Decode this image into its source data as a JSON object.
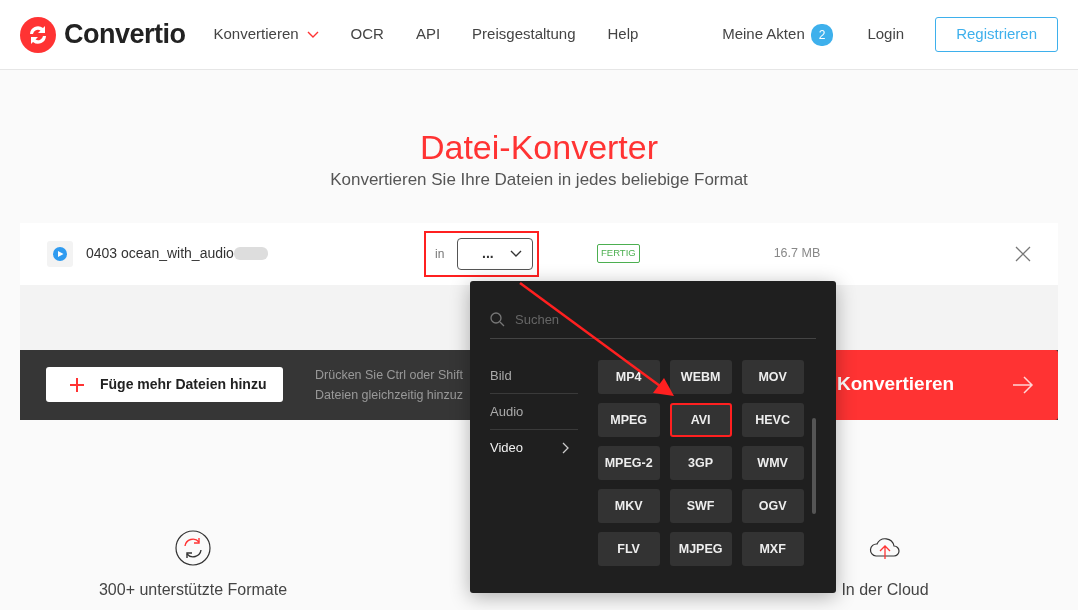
{
  "header": {
    "logo": "Convertio",
    "nav": [
      {
        "label": "Konvertieren",
        "dropdown": true
      },
      {
        "label": "OCR",
        "dropdown": false
      },
      {
        "label": "API",
        "dropdown": false
      },
      {
        "label": "Preisgestaltung",
        "dropdown": false
      },
      {
        "label": "Help",
        "dropdown": false
      }
    ],
    "files_link": {
      "label": "Meine Akten",
      "count": "2"
    },
    "login": "Login",
    "register": "Registrieren"
  },
  "hero": {
    "title": "Datei-Konverter",
    "subtitle": "Konvertieren Sie Ihre Dateien in jedes beliebige Format"
  },
  "file": {
    "name": "0403 ocean_with_audio",
    "to_label": "in",
    "format_value": "...",
    "annotated": true,
    "status": "FERTIG",
    "size": "16.7 MB"
  },
  "format_menu": {
    "search_placeholder": "Suchen",
    "categories": [
      {
        "label": "Bild",
        "selected": false
      },
      {
        "label": "Audio",
        "selected": false
      },
      {
        "label": "Video",
        "selected": true
      }
    ],
    "formats": [
      {
        "label": "MP4",
        "annotated": false
      },
      {
        "label": "WEBM",
        "annotated": false
      },
      {
        "label": "MOV",
        "annotated": false
      },
      {
        "label": "MPEG",
        "annotated": false
      },
      {
        "label": "AVI",
        "annotated": true
      },
      {
        "label": "HEVC",
        "annotated": false
      },
      {
        "label": "MPEG-2",
        "annotated": false
      },
      {
        "label": "3GP",
        "annotated": false
      },
      {
        "label": "WMV",
        "annotated": false
      },
      {
        "label": "MKV",
        "annotated": false
      },
      {
        "label": "SWF",
        "annotated": false
      },
      {
        "label": "OGV",
        "annotated": false
      },
      {
        "label": "FLV",
        "annotated": false
      },
      {
        "label": "MJPEG",
        "annotated": false
      },
      {
        "label": "MXF",
        "annotated": false
      }
    ]
  },
  "add_bar": {
    "add_button": "Füge mehr Dateien hinzu",
    "hint_lines": [
      "Drücken Sie Ctrl oder Shift",
      "Dateien gleichzeitig hinzuz"
    ],
    "convert_button": "Konvertieren"
  },
  "features": [
    {
      "kind": "formats",
      "label": "300+ unterstützte Formate"
    },
    {
      "kind": "cloud",
      "label": "In der Cloud"
    }
  ]
}
